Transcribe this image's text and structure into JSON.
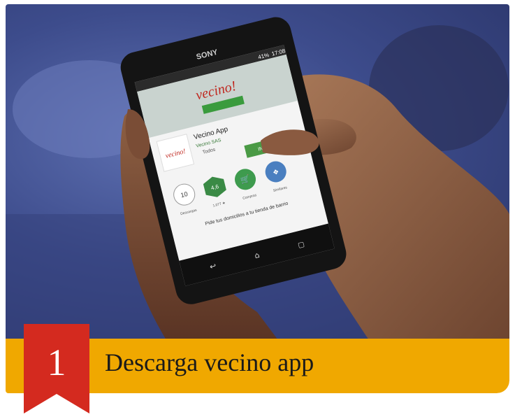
{
  "colors": {
    "caption_bar": "#f0a800",
    "ribbon": "#d42a1f",
    "background": "#3d4c8c"
  },
  "step": {
    "number": "1",
    "title": "Descarga vecino app"
  },
  "phone": {
    "brand": "SONY",
    "status_time": "17:08",
    "status_battery": "41%",
    "app_name": "Vecino App",
    "developer": "Vecino SAS",
    "rating_label": "Todos",
    "install_label": "INSTALAR",
    "downloads": "10",
    "downloads_label": "Descargas",
    "rating_value": "4,6",
    "rating_caption": "1.077 ★",
    "category_label": "Compras",
    "similar_label": "Similares",
    "tagline": "Pide tus domicilios a tu tienda de barrio",
    "logo_text": "vecino!"
  }
}
